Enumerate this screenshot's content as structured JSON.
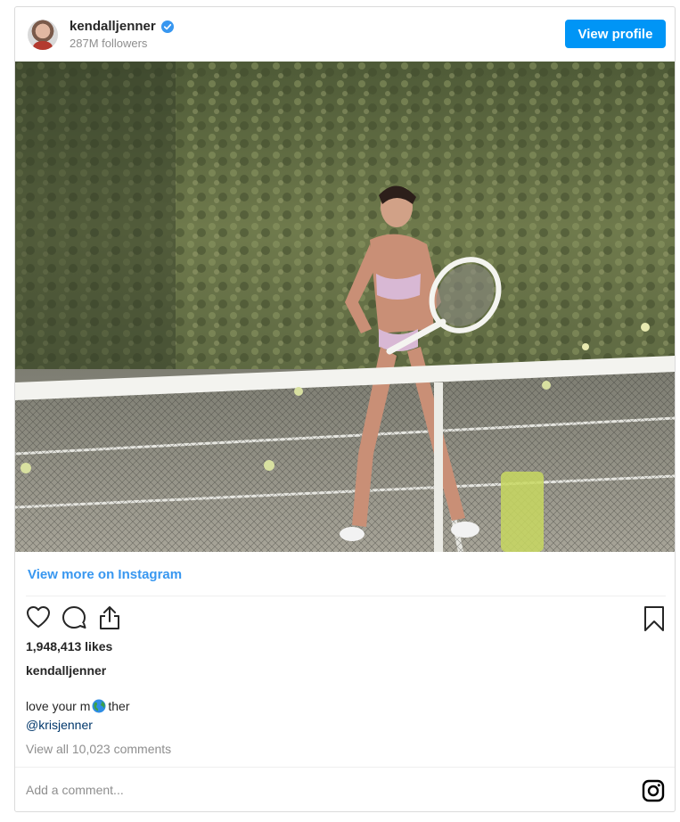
{
  "header": {
    "username": "kendalljenner",
    "followers": "287M followers",
    "view_profile_label": "View profile",
    "verified_icon": "verified-badge-icon",
    "accent": "#0095f6"
  },
  "media": {
    "icon": "tennis-video-frame"
  },
  "view_more_label": "View more on Instagram",
  "actions": {
    "like_icon": "heart-icon",
    "comment_icon": "comment-icon",
    "share_icon": "share-icon",
    "save_icon": "bookmark-icon"
  },
  "likes": "1,948,413 likes",
  "author": "kendalljenner",
  "caption": {
    "before": "love your m",
    "emoji": "globe-emoji",
    "after": "ther"
  },
  "mention": "@krisjenner",
  "view_comments": "View all 10,023 comments",
  "comment_input": {
    "placeholder": "Add a comment...",
    "value": ""
  },
  "footer_icon": "instagram-icon"
}
